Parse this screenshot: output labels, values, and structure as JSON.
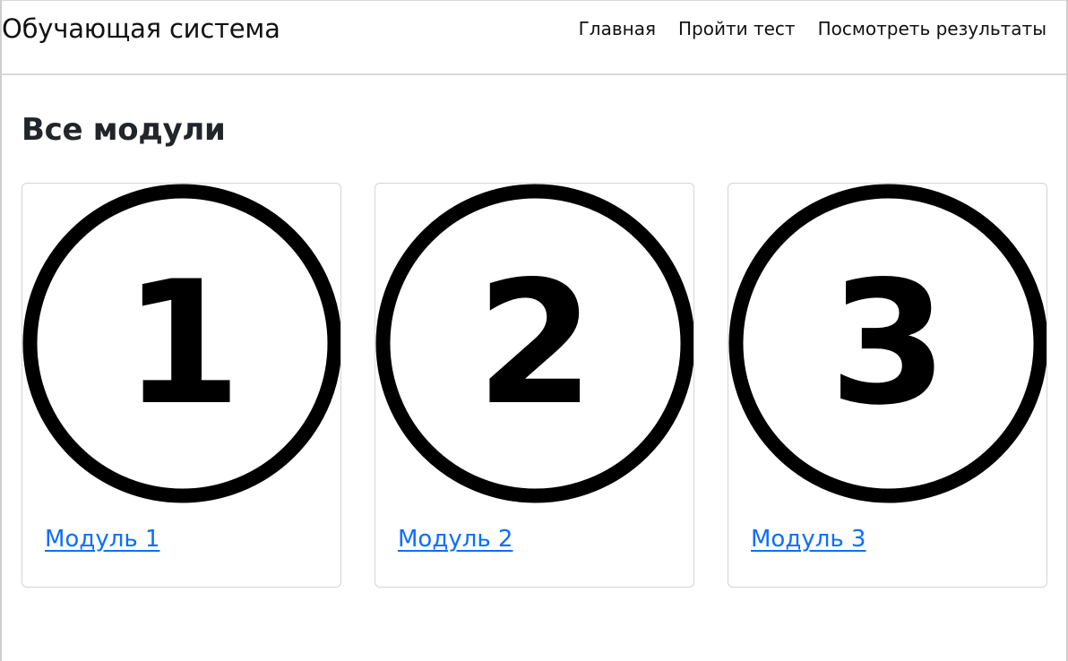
{
  "navbar": {
    "brand": "Обучающая система",
    "links": [
      {
        "label": "Главная"
      },
      {
        "label": "Пройти тест"
      },
      {
        "label": "Посмотреть результаты"
      }
    ]
  },
  "main": {
    "title": "Все модули",
    "modules": [
      {
        "number": "1",
        "link_label": "Модуль 1",
        "image_icon": "number-1-circle-icon"
      },
      {
        "number": "2",
        "link_label": "Модуль 2",
        "image_icon": "number-2-circle-icon"
      },
      {
        "number": "3",
        "link_label": "Модуль 3",
        "image_icon": "number-3-circle-icon"
      }
    ]
  },
  "colors": {
    "link": "#0d6efd",
    "text": "#212529",
    "border": "#d4d4d4"
  }
}
